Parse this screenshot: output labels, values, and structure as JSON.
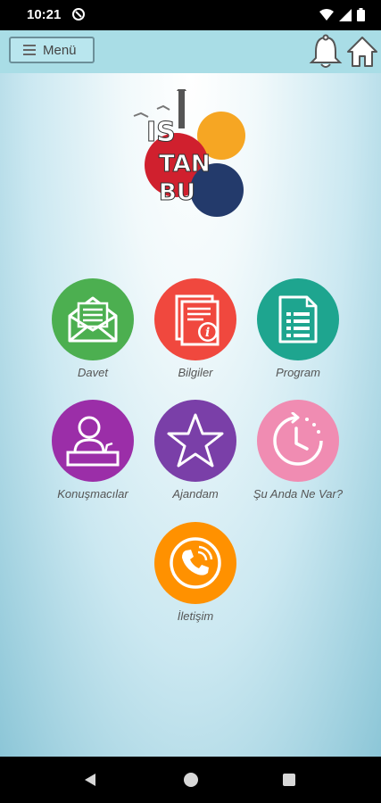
{
  "status": {
    "time": "10:21"
  },
  "header": {
    "menu_label": "Menü"
  },
  "tiles": [
    {
      "label": "Davet",
      "color": "#4caf50",
      "icon": "envelope-icon"
    },
    {
      "label": "Bilgiler",
      "color": "#f0483e",
      "icon": "document-info-icon"
    },
    {
      "label": "Program",
      "color": "#1ea58f",
      "icon": "program-list-icon"
    },
    {
      "label": "Konuşmacılar",
      "color": "#9b2ea8",
      "icon": "speaker-icon"
    },
    {
      "label": "Ajandam",
      "color": "#7a3fa8",
      "icon": "star-icon"
    },
    {
      "label": "Şu Anda Ne Var?",
      "color": "#f08cb2",
      "icon": "clock-icon"
    },
    {
      "label": "İletişim",
      "color": "#ff9100",
      "icon": "phone-icon"
    }
  ],
  "colors": {
    "topbar": "#a9dde6",
    "background_center": "#ffffff",
    "background_edge": "#8cc6d7"
  }
}
